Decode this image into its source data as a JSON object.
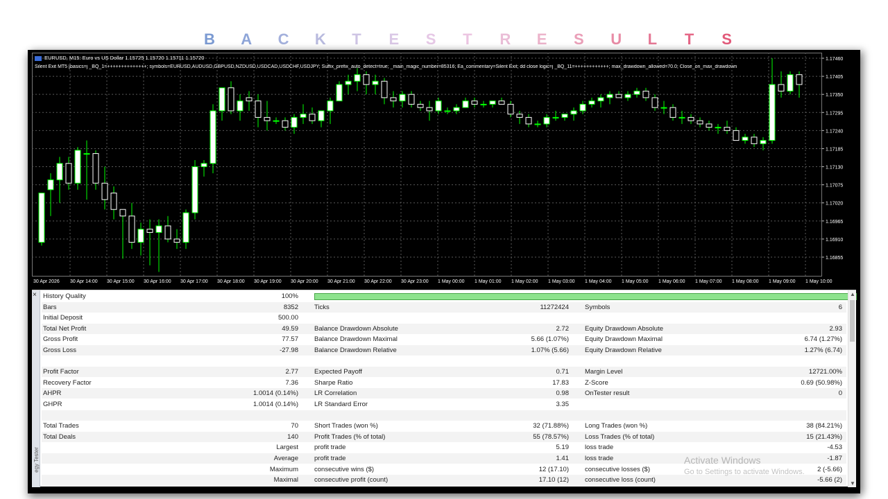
{
  "title_letters": [
    "B",
    "A",
    "C",
    "K",
    "T",
    "E",
    "S",
    "T",
    "R",
    "E",
    "S",
    "U",
    "L",
    "T",
    "S"
  ],
  "title_colors": [
    "#7b9ad2",
    "#8ea5d8",
    "#a3b0dc",
    "#b8bade",
    "#cec4e4",
    "#dac8e6",
    "#e6c8e6",
    "#ecc5e2",
    "#eabed7",
    "#ecb4cb",
    "#ea9fb8",
    "#e88ba5",
    "#e57895",
    "#e56787",
    "#e25a7a"
  ],
  "chart": {
    "symbol_line": "EURUSD, M15:  Euro vs US Dollar  1.15725 1.15720 1.15711 1.15720",
    "ea_line": "Silent Exit MT5 [basics=j _BQ_1=++++++++++++++; symbols=EURUSD,AUDUSD,GBPUSD,NZDUSD,USDCAD,USDCHF,USDJPY; Suffix_prefix_auto_detect=true; _main_magic_number=85316; Ea_commentary=Silent Exit; dd close logic=j _BQ_11=++++++++++++; max_drawdown_allowed=70.0; Close_on_max_drawdown",
    "price_labels": [
      "1.17460",
      "1.17405",
      "1.17350",
      "1.17295",
      "1.17240",
      "1.17185",
      "1.17130",
      "1.17075",
      "1.17020",
      "1.16965",
      "1.16910",
      "1.16855"
    ],
    "time_labels": [
      "30 Apr 2026",
      "30 Apr 14:00",
      "30 Apr 15:00",
      "30 Apr 16:00",
      "30 Apr 17:00",
      "30 Apr 18:00",
      "30 Apr 19:00",
      "30 Apr 20:00",
      "30 Apr 21:00",
      "30 Apr 22:00",
      "30 Apr 23:00",
      "1 May 00:00",
      "1 May 01:00",
      "1 May 02:00",
      "1 May 03:00",
      "1 May 04:00",
      "1 May 05:00",
      "1 May 06:00",
      "1 May 07:00",
      "1 May 08:00",
      "1 May 09:00",
      "1 May 10:00"
    ],
    "colors": {
      "bull": "#ffffff",
      "bear_body": "#000000",
      "wick": "#00ff00",
      "grid": "#5a5a5a",
      "bg": "#000000"
    },
    "candles": [
      [
        1.169,
        1.1705,
        1.1689,
        1.1705
      ],
      [
        1.1706,
        1.1711,
        1.1698,
        1.1709
      ],
      [
        1.1709,
        1.1716,
        1.1702,
        1.1714
      ],
      [
        1.1714,
        1.1716,
        1.1706,
        1.1708
      ],
      [
        1.1708,
        1.1719,
        1.1706,
        1.1718
      ],
      [
        1.1717,
        1.1721,
        1.1703,
        1.1717
      ],
      [
        1.1717,
        1.1718,
        1.1706,
        1.1708
      ],
      [
        1.1708,
        1.1713,
        1.17,
        1.1703
      ],
      [
        1.1705,
        1.1707,
        1.1697,
        1.17
      ],
      [
        1.17,
        1.17,
        1.1685,
        1.1698
      ],
      [
        1.1698,
        1.1702,
        1.1688,
        1.169
      ],
      [
        1.169,
        1.1696,
        1.1686,
        1.1694
      ],
      [
        1.1694,
        1.1697,
        1.1683,
        1.1693
      ],
      [
        1.1693,
        1.1697,
        1.1681,
        1.1695
      ],
      [
        1.1695,
        1.1698,
        1.169,
        1.1691
      ],
      [
        1.1691,
        1.1694,
        1.1688,
        1.169
      ],
      [
        1.169,
        1.17,
        1.1688,
        1.1699
      ],
      [
        1.1699,
        1.1715,
        1.1697,
        1.1713
      ],
      [
        1.1713,
        1.1715,
        1.171,
        1.1714
      ],
      [
        1.1714,
        1.1732,
        1.1711,
        1.173
      ],
      [
        1.173,
        1.1737,
        1.1727,
        1.1737
      ],
      [
        1.1737,
        1.1739,
        1.1729,
        1.173
      ],
      [
        1.173,
        1.1735,
        1.1727,
        1.1733
      ],
      [
        1.1734,
        1.1736,
        1.173,
        1.1733
      ],
      [
        1.1733,
        1.1735,
        1.1725,
        1.1728
      ],
      [
        1.1728,
        1.1733,
        1.1724,
        1.1727
      ],
      [
        1.1727,
        1.1728,
        1.1726,
        1.1727
      ],
      [
        1.1727,
        1.1728,
        1.1724,
        1.1725
      ],
      [
        1.1725,
        1.1729,
        1.1723,
        1.1728
      ],
      [
        1.1728,
        1.1732,
        1.1726,
        1.1729
      ],
      [
        1.1729,
        1.1731,
        1.1726,
        1.1727
      ],
      [
        1.1727,
        1.173,
        1.1725,
        1.173
      ],
      [
        1.173,
        1.1734,
        1.1726,
        1.1733
      ],
      [
        1.1733,
        1.1739,
        1.1733,
        1.1738
      ],
      [
        1.1738,
        1.1741,
        1.1735,
        1.1739
      ],
      [
        1.1739,
        1.1743,
        1.1736,
        1.1741
      ],
      [
        1.1741,
        1.1742,
        1.1735,
        1.1738
      ],
      [
        1.1738,
        1.1741,
        1.1735,
        1.1739
      ],
      [
        1.1739,
        1.174,
        1.1732,
        1.1734
      ],
      [
        1.1734,
        1.1736,
        1.1731,
        1.1733
      ],
      [
        1.1733,
        1.1736,
        1.1731,
        1.1735
      ],
      [
        1.1735,
        1.1736,
        1.1731,
        1.1732
      ],
      [
        1.1732,
        1.1733,
        1.173,
        1.1731
      ],
      [
        1.1731,
        1.1733,
        1.1727,
        1.173
      ],
      [
        1.173,
        1.1734,
        1.1729,
        1.1733
      ],
      [
        1.173,
        1.1731,
        1.1729,
        1.173
      ],
      [
        1.173,
        1.1732,
        1.1729,
        1.1731
      ],
      [
        1.1731,
        1.1734,
        1.1731,
        1.1733
      ],
      [
        1.1733,
        1.1734,
        1.1731,
        1.1732
      ],
      [
        1.1732,
        1.1733,
        1.1731,
        1.1732
      ],
      [
        1.1732,
        1.1733,
        1.1731,
        1.1733
      ],
      [
        1.1733,
        1.1734,
        1.1732,
        1.1732
      ],
      [
        1.1732,
        1.1733,
        1.1728,
        1.1729
      ],
      [
        1.1729,
        1.173,
        1.1726,
        1.1728
      ],
      [
        1.1728,
        1.1729,
        1.1725,
        1.1726
      ],
      [
        1.1726,
        1.1727,
        1.1725,
        1.1726
      ],
      [
        1.1726,
        1.1729,
        1.1725,
        1.1728
      ],
      [
        1.1728,
        1.173,
        1.1727,
        1.1728
      ],
      [
        1.1728,
        1.1729,
        1.1727,
        1.1729
      ],
      [
        1.1729,
        1.1731,
        1.1727,
        1.173
      ],
      [
        1.173,
        1.1733,
        1.1729,
        1.1732
      ],
      [
        1.1732,
        1.1734,
        1.1731,
        1.1733
      ],
      [
        1.1733,
        1.1735,
        1.1731,
        1.1734
      ],
      [
        1.1734,
        1.1736,
        1.1732,
        1.1735
      ],
      [
        1.1735,
        1.1736,
        1.1734,
        1.1734
      ],
      [
        1.1734,
        1.1736,
        1.1733,
        1.1735
      ],
      [
        1.1735,
        1.1737,
        1.1734,
        1.1736
      ],
      [
        1.1736,
        1.1737,
        1.1733,
        1.1734
      ],
      [
        1.1734,
        1.1735,
        1.173,
        1.1731
      ],
      [
        1.1731,
        1.1733,
        1.1729,
        1.1731
      ],
      [
        1.1731,
        1.1732,
        1.1727,
        1.1728
      ],
      [
        1.1728,
        1.173,
        1.1726,
        1.1728
      ],
      [
        1.1728,
        1.1729,
        1.1726,
        1.1727
      ],
      [
        1.1727,
        1.1728,
        1.1725,
        1.1726
      ],
      [
        1.1726,
        1.1727,
        1.1724,
        1.1725
      ],
      [
        1.1725,
        1.1726,
        1.1723,
        1.1725
      ],
      [
        1.1725,
        1.1727,
        1.1723,
        1.1724
      ],
      [
        1.1724,
        1.1725,
        1.1721,
        1.1721
      ],
      [
        1.1721,
        1.1723,
        1.172,
        1.1722
      ],
      [
        1.1722,
        1.1723,
        1.1719,
        1.172
      ],
      [
        1.172,
        1.1722,
        1.1718,
        1.1721
      ],
      [
        1.1721,
        1.1746,
        1.172,
        1.1738
      ],
      [
        1.1738,
        1.1742,
        1.1734,
        1.1736
      ],
      [
        1.1736,
        1.1742,
        1.1735,
        1.1741
      ],
      [
        1.1741,
        1.1742,
        1.1734,
        1.1738
      ]
    ]
  },
  "report": {
    "side_close": "×",
    "side_label": "egy Tester",
    "rows": [
      {
        "label": "History Quality",
        "value": "100%"
      },
      {
        "label": "Bars",
        "value": "8352",
        "l2": "Ticks",
        "v2": "11272424",
        "l3": "Symbols",
        "v3": "6"
      },
      {
        "label": "Initial Deposit",
        "value": "500.00"
      },
      {
        "label": "Total Net Profit",
        "value": "49.59",
        "l2": "Balance Drawdown Absolute",
        "v2": "2.72",
        "l3": "Equity Drawdown Absolute",
        "v3": "2.93"
      },
      {
        "label": "Gross Profit",
        "value": "77.57",
        "l2": "Balance Drawdown Maximal",
        "v2": "5.66 (1.07%)",
        "l3": "Equity Drawdown Maximal",
        "v3": "6.74 (1.27%)"
      },
      {
        "label": "Gross Loss",
        "value": "-27.98",
        "l2": "Balance Drawdown Relative",
        "v2": "1.07% (5.66)",
        "l3": "Equity Drawdown Relative",
        "v3": "1.27% (6.74)"
      },
      {
        "label": "",
        "value": ""
      },
      {
        "label": "Profit Factor",
        "value": "2.77",
        "l2": "Expected Payoff",
        "v2": "0.71",
        "l3": "Margin Level",
        "v3": "12721.00%"
      },
      {
        "label": "Recovery Factor",
        "value": "7.36",
        "l2": "Sharpe Ratio",
        "v2": "17.83",
        "l3": "Z-Score",
        "v3": "0.69 (50.98%)"
      },
      {
        "label": "AHPR",
        "value": "1.0014 (0.14%)",
        "l2": "LR Correlation",
        "v2": "0.98",
        "l3": "OnTester result",
        "v3": "0"
      },
      {
        "label": "GHPR",
        "value": "1.0014 (0.14%)",
        "l2": "LR Standard Error",
        "v2": "3.35"
      },
      {
        "label": "",
        "value": ""
      },
      {
        "label": "Total Trades",
        "value": "70",
        "l2": "Short Trades (won %)",
        "v2": "32 (71.88%)",
        "l3": "Long Trades (won %)",
        "v3": "38 (84.21%)"
      },
      {
        "label": "Total Deals",
        "value": "140",
        "l2": "Profit Trades (% of total)",
        "v2": "55 (78.57%)",
        "l3": "Loss Trades (% of total)",
        "v3": "15 (21.43%)"
      },
      {
        "label": "",
        "value": "Largest",
        "l2": "profit trade",
        "v2": "5.19",
        "l3": "loss trade",
        "v3": "-4.53"
      },
      {
        "label": "",
        "value": "Average",
        "l2": "profit trade",
        "v2": "1.41",
        "l3": "loss trade",
        "v3": "-1.87"
      },
      {
        "label": "",
        "value": "Maximum",
        "l2": "consecutive wins ($)",
        "v2": "12 (17.10)",
        "l3": "consecutive losses ($)",
        "v3": "2 (-5.66)"
      },
      {
        "label": "",
        "value": "Maximal",
        "l2": "consecutive profit (count)",
        "v2": "17.10 (12)",
        "l3": "consecutive loss (count)",
        "v3": "-5.66 (2)"
      }
    ],
    "history_quality_bar_fraction": 1.0,
    "history_quality_bar_color": "#8ee38e",
    "watermark_title": "Activate Windows",
    "watermark_text": "Go to Settings to activate Windows."
  }
}
